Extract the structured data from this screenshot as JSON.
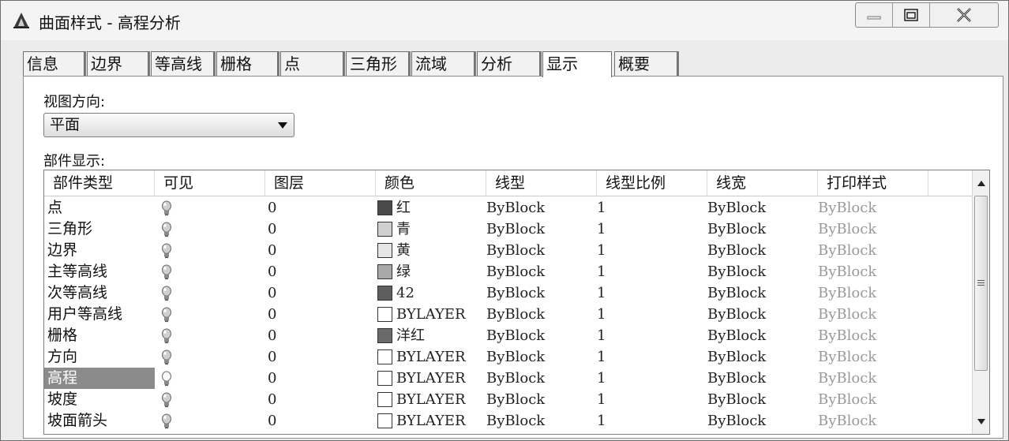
{
  "window": {
    "title": "曲面样式 - 高程分析",
    "icon": "autocad-a-icon"
  },
  "tabs": [
    {
      "label": "信息",
      "width": 78
    },
    {
      "label": "边界",
      "width": 78
    },
    {
      "label": "等高线",
      "width": 80
    },
    {
      "label": "栅格",
      "width": 78
    },
    {
      "label": "点",
      "width": 80
    },
    {
      "label": "三角形",
      "width": 80
    },
    {
      "label": "流域",
      "width": 80
    },
    {
      "label": "分析",
      "width": 80
    },
    {
      "label": "显示",
      "width": 88,
      "active": true
    },
    {
      "label": "概要",
      "width": 80
    }
  ],
  "view_direction": {
    "label": "视图方向:",
    "selected": "平面"
  },
  "component_display": {
    "label": "部件显示:",
    "columns": [
      "部件类型",
      "可见",
      "图层",
      "颜色",
      "线型",
      "线型比例",
      "线宽",
      "打印样式"
    ],
    "rows": [
      {
        "name": "点",
        "layer": "0",
        "color": "红",
        "swatch": "#4a4a4a",
        "linetype": "ByBlock",
        "scale": "1",
        "lineweight": "ByBlock",
        "plot": "ByBlock"
      },
      {
        "name": "三角形",
        "layer": "0",
        "color": "青",
        "swatch": "#cfcfcf",
        "linetype": "ByBlock",
        "scale": "1",
        "lineweight": "ByBlock",
        "plot": "ByBlock"
      },
      {
        "name": "边界",
        "layer": "0",
        "color": "黄",
        "swatch": "#e6e6e6",
        "linetype": "ByBlock",
        "scale": "1",
        "lineweight": "ByBlock",
        "plot": "ByBlock"
      },
      {
        "name": "主等高线",
        "layer": "0",
        "color": "绿",
        "swatch": "#a9a9a9",
        "linetype": "ByBlock",
        "scale": "1",
        "lineweight": "ByBlock",
        "plot": "ByBlock"
      },
      {
        "name": "次等高线",
        "layer": "0",
        "color": "42",
        "swatch": "#5e5e5e",
        "linetype": "ByBlock",
        "scale": "1",
        "lineweight": "ByBlock",
        "plot": "ByBlock"
      },
      {
        "name": "用户等高线",
        "layer": "0",
        "color": "BYLAYER",
        "swatch": "#ffffff",
        "linetype": "ByBlock",
        "scale": "1",
        "lineweight": "ByBlock",
        "plot": "ByBlock"
      },
      {
        "name": "栅格",
        "layer": "0",
        "color": "洋红",
        "swatch": "#6a6a6a",
        "linetype": "ByBlock",
        "scale": "1",
        "lineweight": "ByBlock",
        "plot": "ByBlock"
      },
      {
        "name": "方向",
        "layer": "0",
        "color": "BYLAYER",
        "swatch": "#ffffff",
        "linetype": "ByBlock",
        "scale": "1",
        "lineweight": "ByBlock",
        "plot": "ByBlock"
      },
      {
        "name": "高程",
        "layer": "0",
        "color": "BYLAYER",
        "swatch": "#ffffff",
        "linetype": "ByBlock",
        "scale": "1",
        "lineweight": "ByBlock",
        "plot": "ByBlock",
        "selected": true,
        "visible": true
      },
      {
        "name": "坡度",
        "layer": "0",
        "color": "BYLAYER",
        "swatch": "#ffffff",
        "linetype": "ByBlock",
        "scale": "1",
        "lineweight": "ByBlock",
        "plot": "ByBlock"
      },
      {
        "name": "坡面箭头",
        "layer": "0",
        "color": "BYLAYER",
        "swatch": "#ffffff",
        "linetype": "ByBlock",
        "scale": "1",
        "lineweight": "ByBlock",
        "plot": "ByBlock"
      }
    ]
  }
}
